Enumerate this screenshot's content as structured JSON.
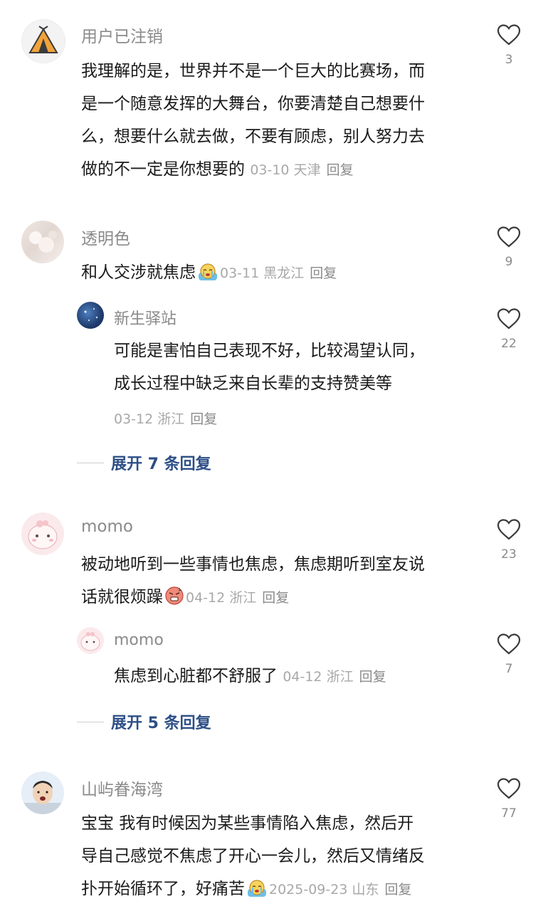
{
  "comments": [
    {
      "username": "用户已注销",
      "text_lines": [
        "我理解的是，世界并不是一个巨大的比赛场，而",
        "是一个随意发挥的大舞台，你要清楚自己想要什",
        "么，想要什么就去做，不要有顾虑，别人努力去",
        "做的不一定是你想要的"
      ],
      "date": "03-10",
      "location": "天津",
      "reply_label": "回复",
      "likes": "3",
      "avatar_icon": "tent-icon"
    },
    {
      "username": "透明色",
      "text_lines": [
        "和人交涉就焦虑"
      ],
      "emoji": "crying-emoji",
      "date": "03-11",
      "location": "黑龙江",
      "reply_label": "回复",
      "likes": "9",
      "replies": [
        {
          "username": "新生驿站",
          "text_lines": [
            "可能是害怕自己表现不好，比较渴望认同，",
            "成长过程中缺乏来自长辈的支持赞美等"
          ],
          "date": "03-12",
          "location": "浙江",
          "reply_label": "回复",
          "likes": "22"
        }
      ],
      "expand_label": "展开 7 条回复"
    },
    {
      "username": "momo",
      "text_lines": [
        "被动地听到一些事情也焦虑，焦虑期听到室友说",
        "话就很烦躁"
      ],
      "emoji": "annoyed-emoji",
      "date": "04-12",
      "location": "浙江",
      "reply_label": "回复",
      "likes": "23",
      "replies": [
        {
          "username": "momo",
          "text_lines": [
            "焦虑到心脏都不舒服了"
          ],
          "date": "04-12",
          "location": "浙江",
          "reply_label": "回复",
          "likes": "7"
        }
      ],
      "expand_label": "展开 5 条回复"
    },
    {
      "username": "山屿眷海湾",
      "text_lines": [
        "宝宝 我有时候因为某些事情陷入焦虑，然后开",
        "导自己感觉不焦虑了开心一会儿，然后又情绪反",
        "扑开始循环了，好痛苦"
      ],
      "emoji": "crying-emoji",
      "date": "2025-09-23",
      "location": "山东",
      "reply_label": "回复",
      "likes": "77"
    }
  ],
  "colors": {
    "expand_link": "#2d4f86",
    "meta": "#a8a8a8",
    "username": "#8a8a8a"
  }
}
